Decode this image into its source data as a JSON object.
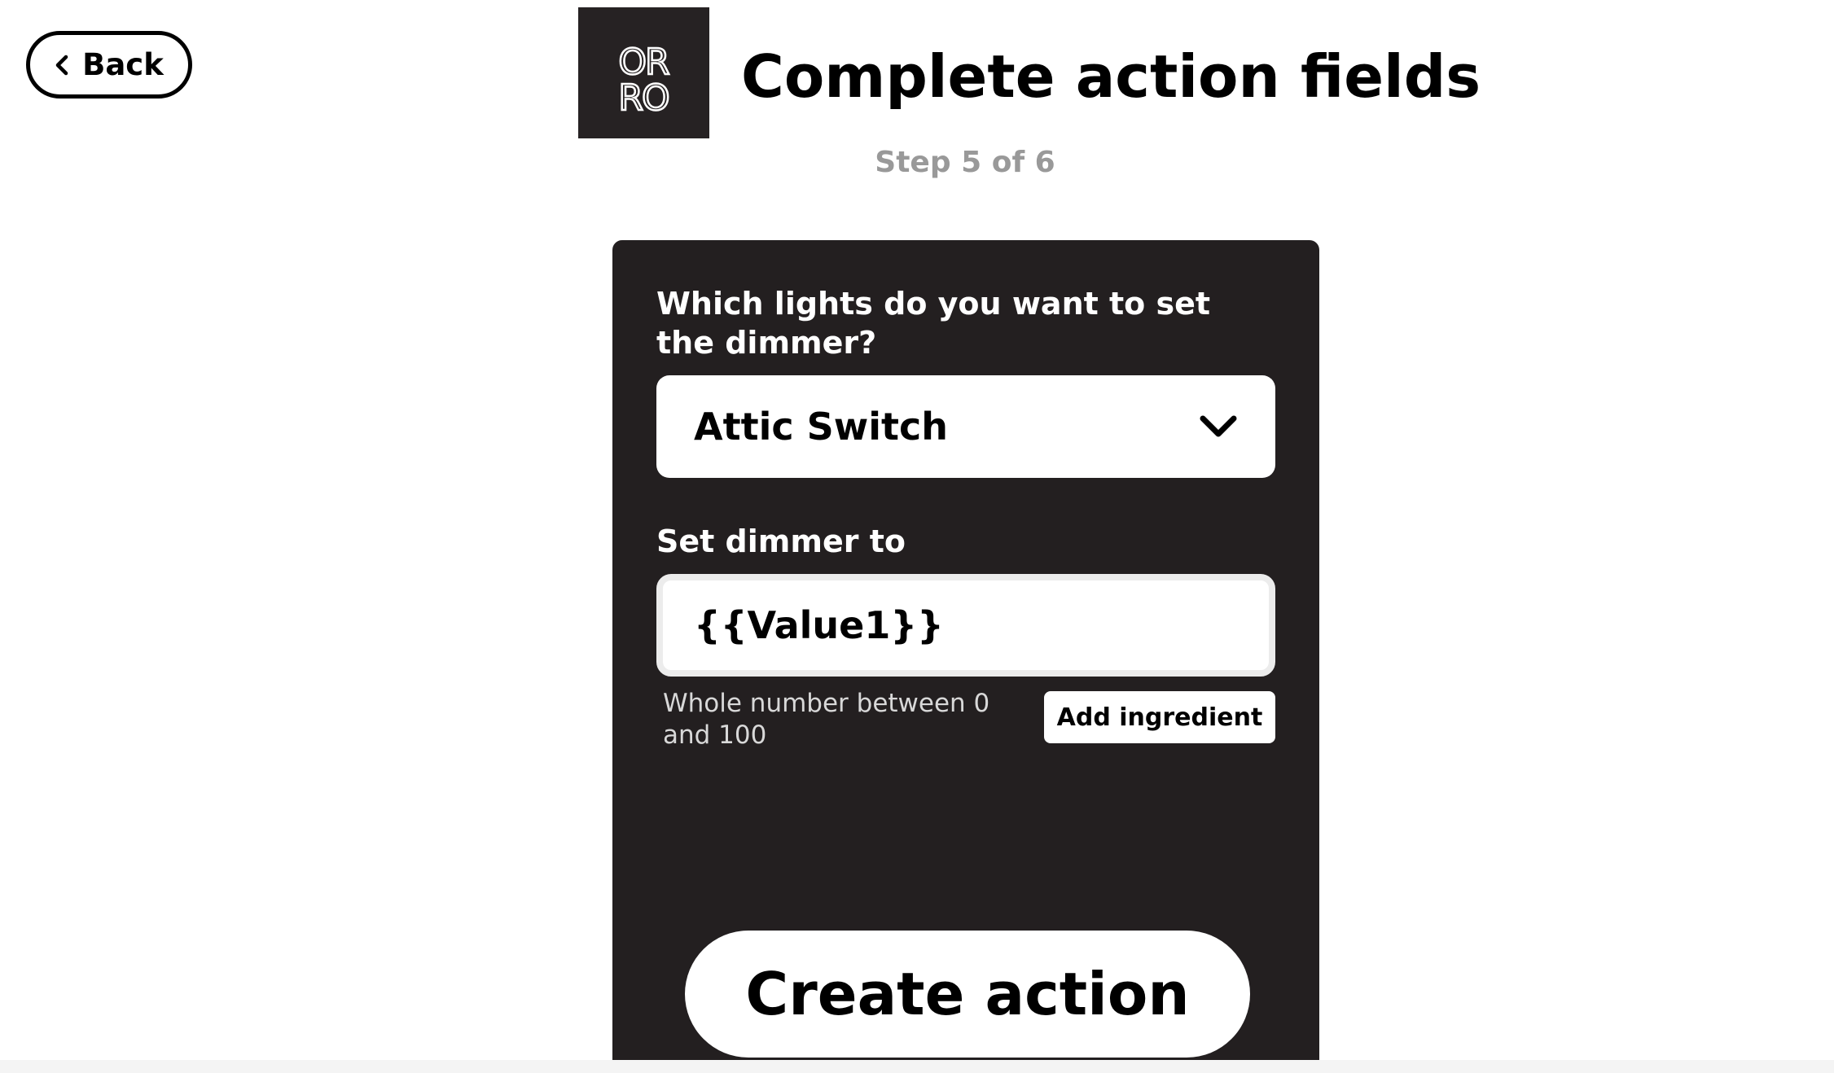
{
  "nav": {
    "back_label": "Back"
  },
  "header": {
    "logo_line1": "OR",
    "logo_line2": "RO",
    "title": "Complete action fields",
    "step": "Step 5 of 6"
  },
  "form": {
    "lights_label": "Which lights do you want to set the dimmer?",
    "lights_value": "Attic Switch",
    "dimmer_label": "Set dimmer to",
    "dimmer_value": "{{Value1}}",
    "dimmer_helper": "Whole number between 0 and 100",
    "add_ingredient_label": "Add ingredient",
    "submit_label": "Create action"
  },
  "colors": {
    "card_background": "#231f20",
    "logo_background": "#262223",
    "step_text": "#999999"
  },
  "icons": {
    "back": "chevron-left-icon",
    "dropdown": "chevron-down-icon"
  }
}
